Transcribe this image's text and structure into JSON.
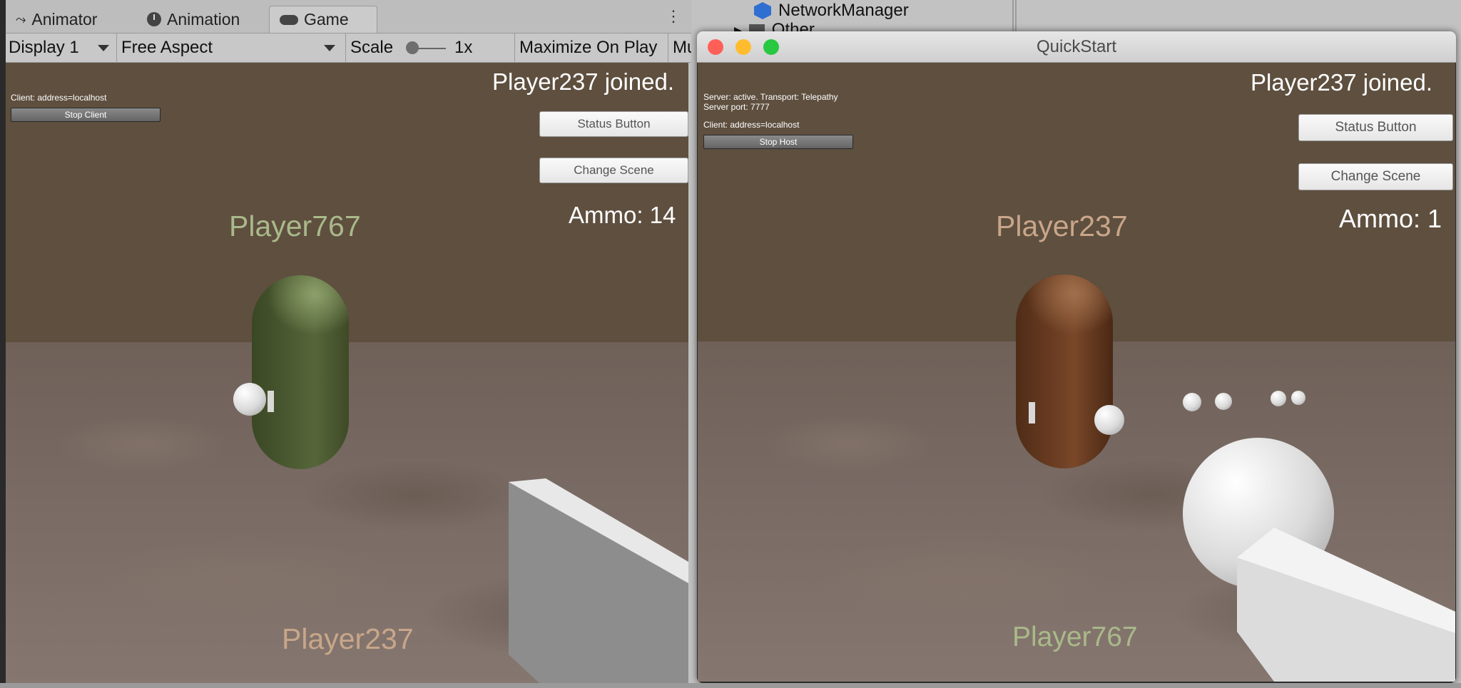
{
  "editor": {
    "tabs": [
      {
        "label": "Animator",
        "icon": "animator-icon"
      },
      {
        "label": "Animation",
        "icon": "clock-icon"
      },
      {
        "label": "Game",
        "icon": "gamepad-icon"
      }
    ],
    "toolbar": {
      "display": "Display 1",
      "aspect": "Free Aspect",
      "scale_label": "Scale",
      "scale_value": "1x",
      "maximize": "Maximize On Play",
      "mute": "Mu"
    }
  },
  "game_left": {
    "joined": "Player237 joined.",
    "client_info": "Client: address=localhost",
    "stop_button": "Stop Client",
    "status_button": "Status Button",
    "change_scene": "Change Scene",
    "ammo": "Ammo: 14",
    "player_name_top": "Player767",
    "player_name_bottom": "Player237",
    "top_name_color": "#aab98a",
    "bottom_name_color": "#c9a68a",
    "capsule_color": "#4b5a31"
  },
  "hierarchy": {
    "item": "NetworkManager",
    "item2": "Other"
  },
  "quickstart": {
    "title": "QuickStart",
    "joined": "Player237 joined.",
    "server_info": "Server: active. Transport: Telepathy",
    "server_port": "Server port: 7777",
    "client_info": "Client: address=localhost",
    "stop_button": "Stop Host",
    "status_button": "Status Button",
    "change_scene": "Change Scene",
    "ammo": "Ammo: 1",
    "player_name_top": "Player237",
    "player_name_bottom": "Player767",
    "top_name_color": "#c9a68a",
    "bottom_name_color": "#aab98a",
    "capsule_color": "#6b3d22",
    "traffic_colors": [
      "#fe5f57",
      "#febc2e",
      "#28c840"
    ]
  }
}
